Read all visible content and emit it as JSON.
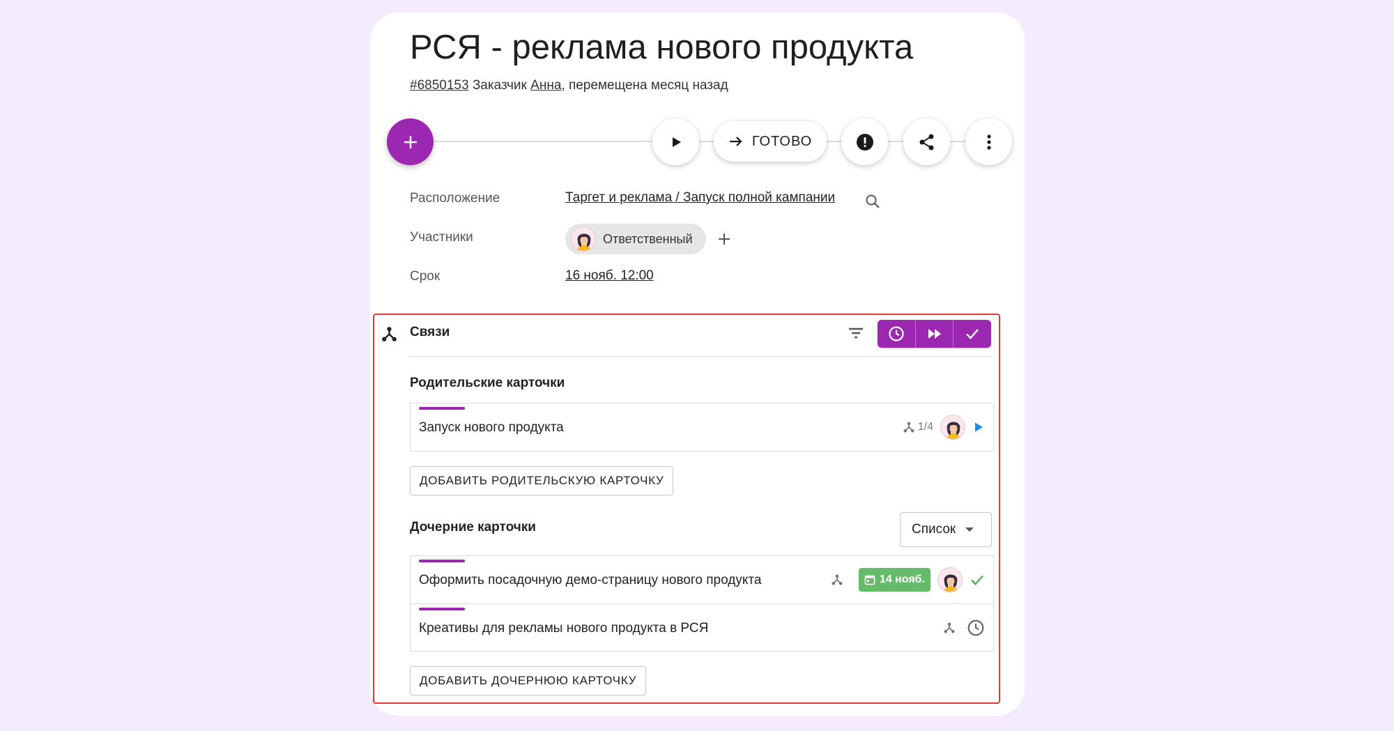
{
  "task": {
    "title": "РСЯ - реклама нового продукта",
    "id": "#6850153",
    "customer_prefix": "Заказчик",
    "customer": "Анна",
    "moved": ", перемещена месяц назад"
  },
  "toolbar": {
    "add_icon": "plus-icon",
    "play_icon": "play-icon",
    "done_label": "ГОТОВО",
    "alert_icon": "alert-icon",
    "share_icon": "share-icon",
    "more_icon": "more-vertical-icon"
  },
  "fields": {
    "location_label": "Расположение",
    "location_value": "Таргет и реклама / Запуск полной кампании",
    "participants_label": "Участники",
    "participant_role": "Ответственный",
    "deadline_label": "Срок",
    "deadline_value": "16 нояб. 12:00"
  },
  "links": {
    "title": "Связи",
    "parents_title": "Родительские карточки",
    "parents": [
      {
        "title": "Запуск нового продукта",
        "count": "1/4"
      }
    ],
    "add_parent_label": "ДОБАВИТЬ РОДИТЕЛЬСКУЮ КАРТОЧКУ",
    "children_title": "Дочерние карточки",
    "view_select": "Список",
    "children": [
      {
        "title": "Оформить посадочную демо-страницу нового продукта",
        "date": "14 нояб."
      },
      {
        "title": "Креативы для рекламы нового продукта в РСЯ"
      }
    ],
    "add_child_label": "ДОБАВИТЬ ДОЧЕРНЮЮ КАРТОЧКУ"
  },
  "colors": {
    "accent": "#9c27b0",
    "done_green": "#66bb6a",
    "section_border": "#e53935",
    "play_blue": "#1e88e5"
  }
}
